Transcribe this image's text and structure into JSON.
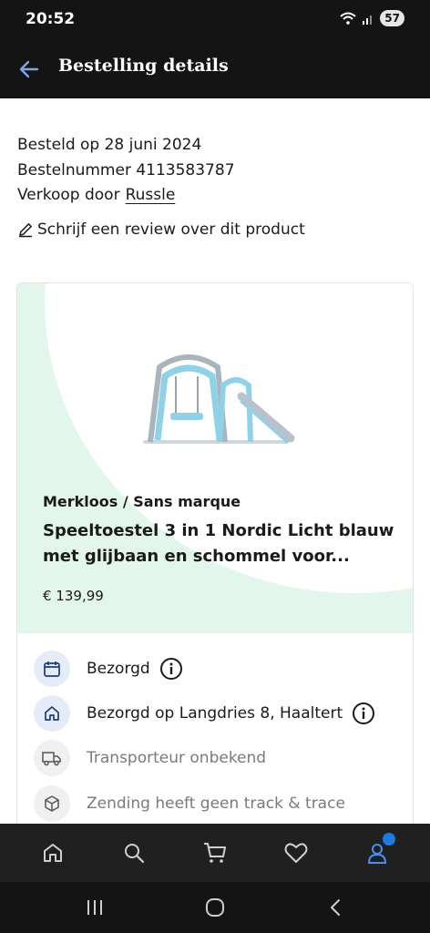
{
  "status_bar": {
    "time": "20:52",
    "battery": "57"
  },
  "app_bar": {
    "title": "Bestelling details"
  },
  "order": {
    "date_line": "Besteld op 28 juni 2024",
    "number_line": "Bestelnummer 4113583787",
    "seller_prefix": "Verkoop door",
    "seller_name": "Russle",
    "review_link": "Schrijf een review over dit product"
  },
  "product": {
    "brand": "Merkloos / Sans marque",
    "title": "Speeltoestel 3 in 1 Nordic Licht blauw met glijbaan en schommel voor...",
    "price": "€ 139,99"
  },
  "statuses": [
    {
      "icon": "calendar-icon",
      "text": "Bezorgd"
    },
    {
      "icon": "house-icon",
      "text": "Bezorgd op Langdries 8, Haaltert"
    },
    {
      "icon": "truck-icon",
      "text": "Transporteur onbekend"
    },
    {
      "icon": "package-icon",
      "text": "Zending heeft geen track & trace"
    }
  ],
  "bottom_nav": [
    "home-icon",
    "search-icon",
    "cart-icon",
    "heart-icon",
    "account-icon"
  ],
  "colors": {
    "dark_bar": "#141414",
    "accent_blue": "#1f7ae0",
    "card_green": "#e3f6ec"
  }
}
